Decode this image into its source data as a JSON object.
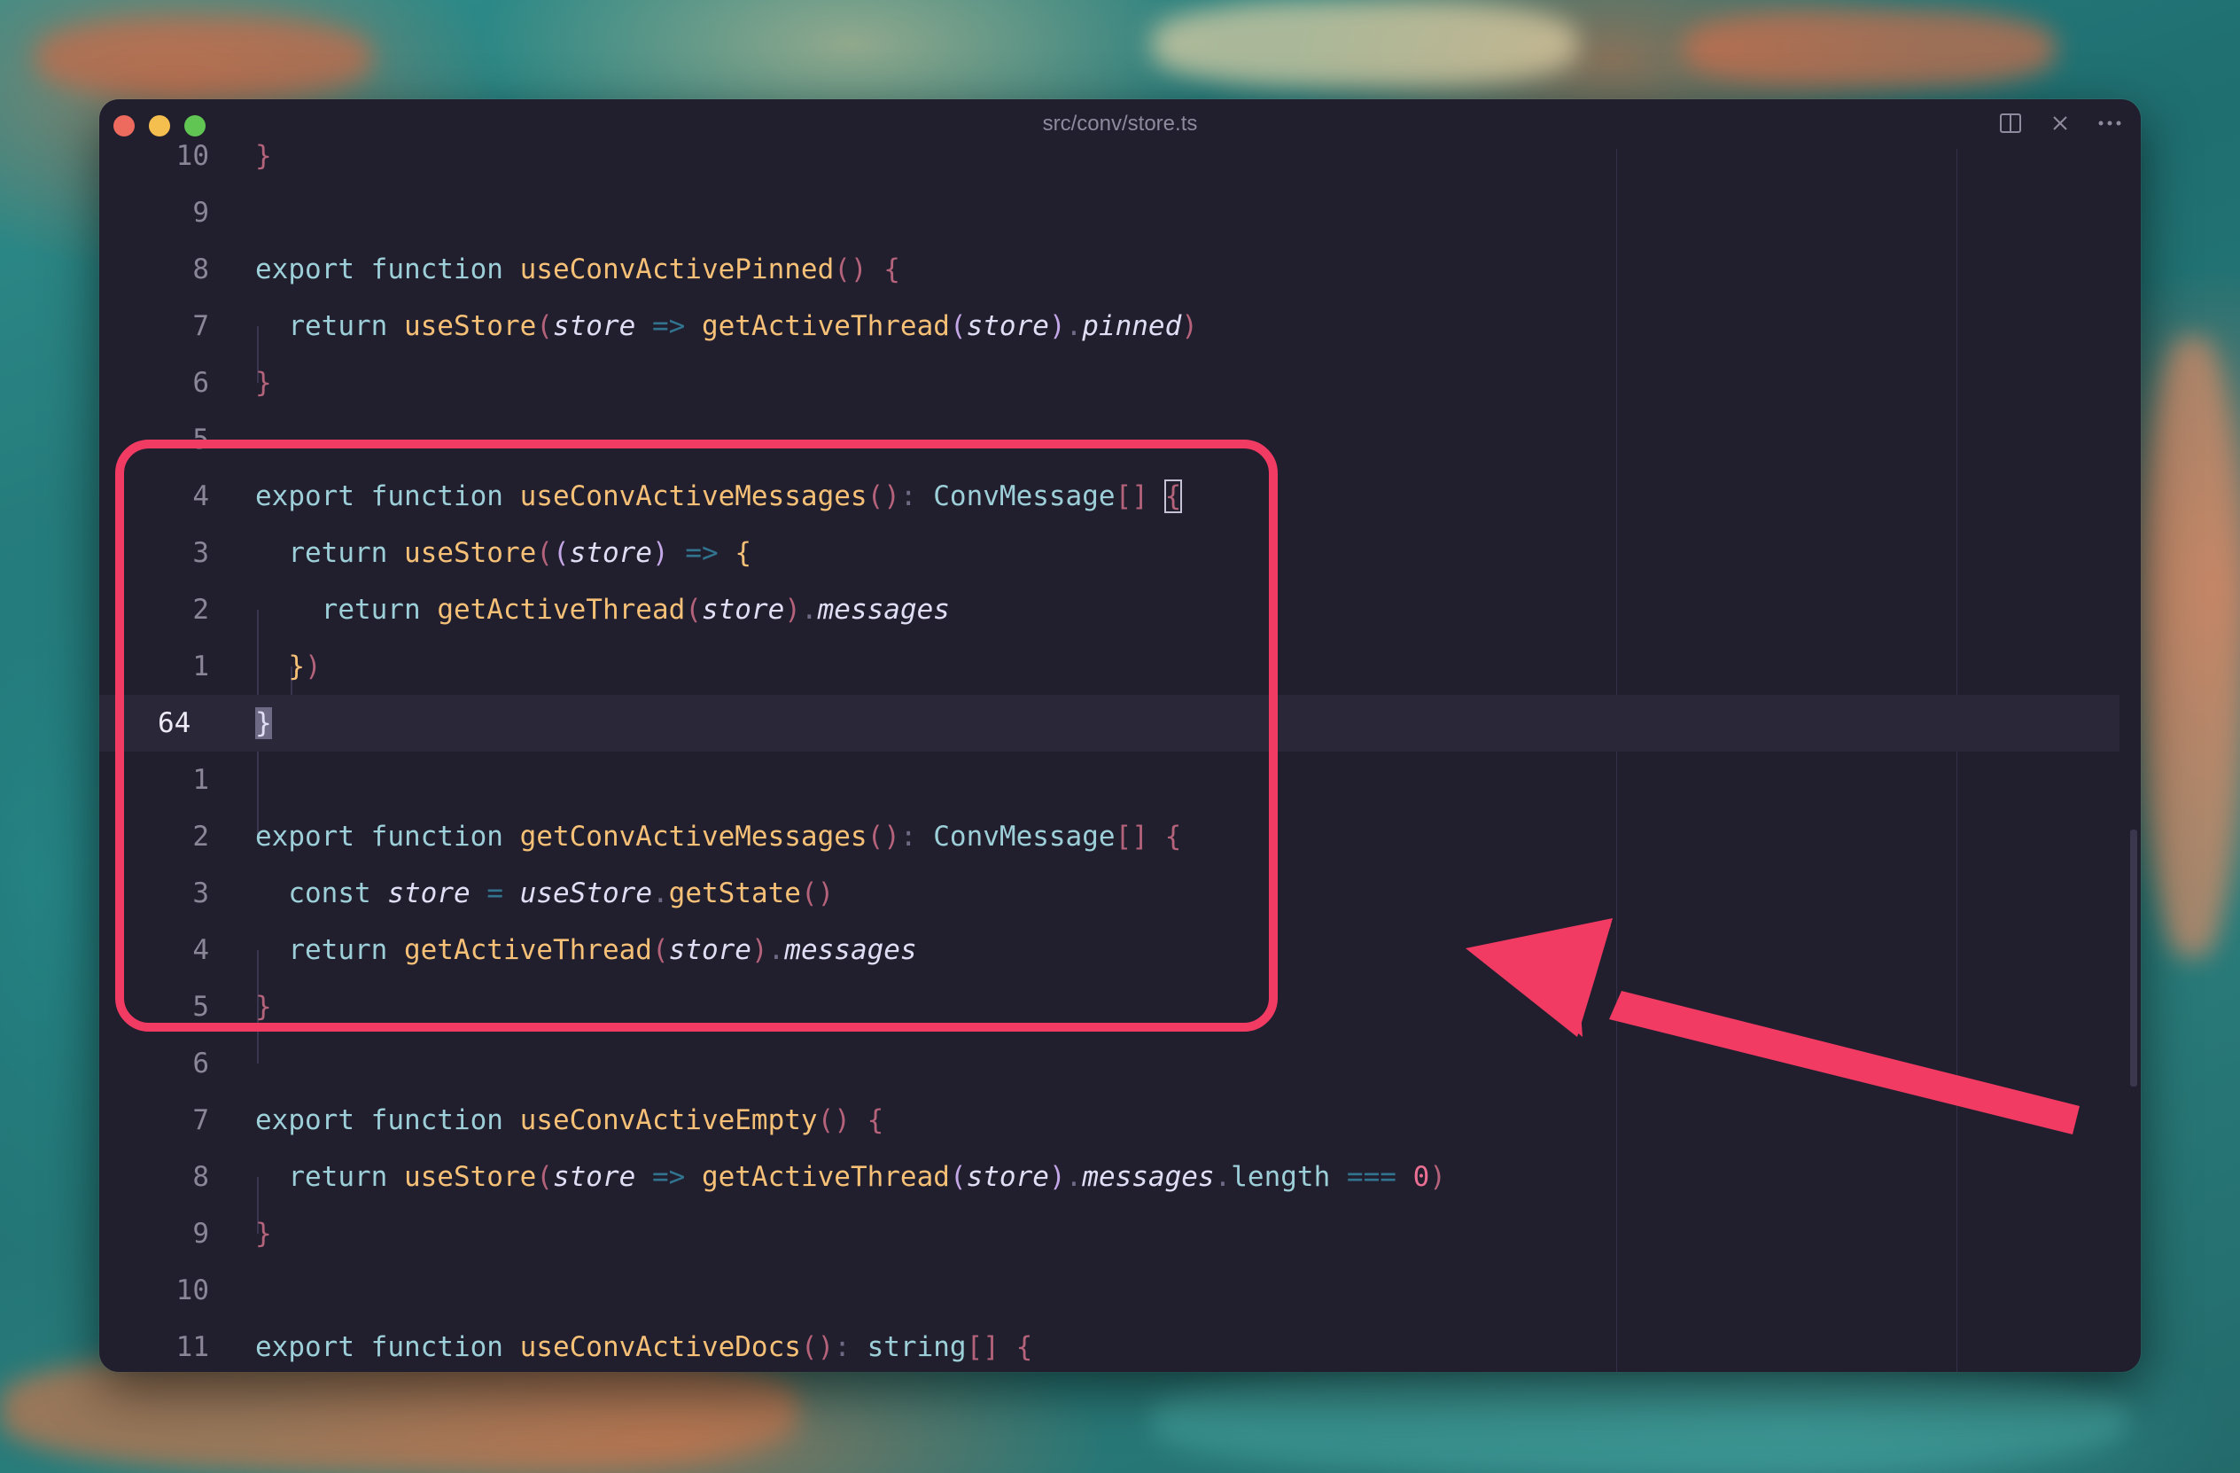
{
  "window": {
    "title": "src/conv/store.ts",
    "actions": [
      "split-editor-icon",
      "close-icon",
      "more-icon"
    ]
  },
  "colors": {
    "highlight": "#f23b63",
    "background": "#211e2e"
  },
  "editor": {
    "current_line": "64",
    "lines": [
      {
        "ln": "10",
        "code": "}"
      },
      {
        "ln": "9",
        "code": ""
      },
      {
        "ln": "8",
        "code": "export function useConvActivePinned() {"
      },
      {
        "ln": "7",
        "code": "  return useStore(store => getActiveThread(store).pinned)"
      },
      {
        "ln": "6",
        "code": "}"
      },
      {
        "ln": "5",
        "code": ""
      },
      {
        "ln": "4",
        "code": "export function useConvActiveMessages(): ConvMessage[] {"
      },
      {
        "ln": "3",
        "code": "  return useStore((store) => {"
      },
      {
        "ln": "2",
        "code": "    return getActiveThread(store).messages"
      },
      {
        "ln": "1",
        "code": "  })"
      },
      {
        "ln": "64",
        "code": "}"
      },
      {
        "ln": "1",
        "code": ""
      },
      {
        "ln": "2",
        "code": "export function getConvActiveMessages(): ConvMessage[] {"
      },
      {
        "ln": "3",
        "code": "  const store = useStore.getState()"
      },
      {
        "ln": "4",
        "code": "  return getActiveThread(store).messages"
      },
      {
        "ln": "5",
        "code": "}"
      },
      {
        "ln": "6",
        "code": ""
      },
      {
        "ln": "7",
        "code": "export function useConvActiveEmpty() {"
      },
      {
        "ln": "8",
        "code": "  return useStore(store => getActiveThread(store).messages.length === 0)"
      },
      {
        "ln": "9",
        "code": "}"
      },
      {
        "ln": "10",
        "code": ""
      },
      {
        "ln": "11",
        "code": "export function useConvActiveDocs(): string[] {"
      }
    ]
  },
  "tokens": {
    "export": "export",
    "function": "function",
    "return": "return",
    "const": "const",
    "store": "store",
    "useStore": "useStore",
    "getActiveThread": "getActiveThread",
    "pinned": "pinned",
    "messages": "messages",
    "length": "length",
    "getState": "getState",
    "ConvMessage": "ConvMessage",
    "string": "string",
    "zero": "0",
    "fn_pinned": "useConvActivePinned",
    "fn_use_messages": "useConvActiveMessages",
    "fn_get_messages": "getConvActiveMessages",
    "fn_empty": "useConvActiveEmpty",
    "fn_docs": "useConvActiveDocs"
  }
}
